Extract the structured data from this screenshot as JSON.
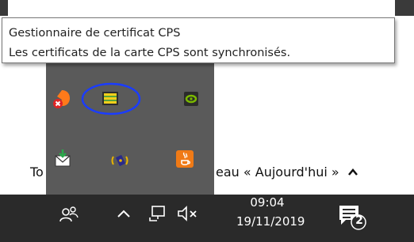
{
  "tooltip": {
    "title": "Gestionnaire de certificat CPS",
    "message": "Les certificats de la carte CPS sont synchronisés."
  },
  "background": {
    "ticker_text": "eau « Aujourd'hui »",
    "ticker_left": "To"
  },
  "tray_popup": {
    "icons": [
      {
        "name": "avast-warning-icon"
      },
      {
        "name": "cps-certificate-icon",
        "highlighted": true,
        "highlight_color": "#1a3cff"
      },
      {
        "name": "nvidia-icon"
      },
      {
        "name": "mail-download-icon"
      },
      {
        "name": "network-device-icon"
      },
      {
        "name": "java-icon"
      }
    ]
  },
  "taskbar": {
    "time": "09:04",
    "date": "19/11/2019",
    "notification_count": "2",
    "icons": [
      "people-icon",
      "show-hidden-icons-chevron",
      "network-icon",
      "volume-muted-icon",
      "action-center-icon"
    ]
  },
  "colors": {
    "taskbar": "#2a2a2a",
    "popup": "#5a5a5a",
    "highlight_ring": "#1a3cff"
  }
}
